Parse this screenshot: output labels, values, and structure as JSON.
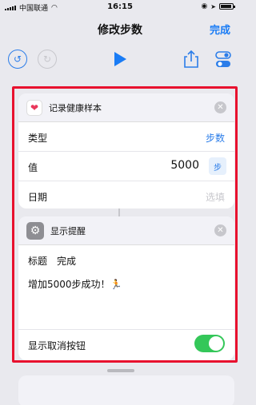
{
  "status_bar": {
    "carrier": "中国联通",
    "time": "16:15"
  },
  "nav": {
    "title": "修改步数",
    "done_label": "完成"
  },
  "toolbar": {
    "undo_icon": "undo-icon",
    "redo_icon": "redo-icon",
    "play_icon": "play-icon",
    "share_icon": "share-icon",
    "settings_icon": "toggle-settings-icon"
  },
  "log_health": {
    "title": "记录健康样本",
    "rows": [
      {
        "key": "类型",
        "value": "步数",
        "value_color": "#2b7de9"
      },
      {
        "key": "值",
        "value": "5000",
        "chip": "步"
      },
      {
        "key": "日期",
        "value": "选填",
        "value_color": "#c7c7cc"
      }
    ]
  },
  "alert": {
    "title": "显示提醒",
    "title_label": "标题",
    "title_value": "完成",
    "message": "增加5000步成功！🏃",
    "cancel_label": "显示取消按钮",
    "cancel_toggle_on": true
  },
  "colors": {
    "accent": "#2b7de9",
    "highlight": "#e8112e",
    "toggle_on": "#34c759"
  }
}
